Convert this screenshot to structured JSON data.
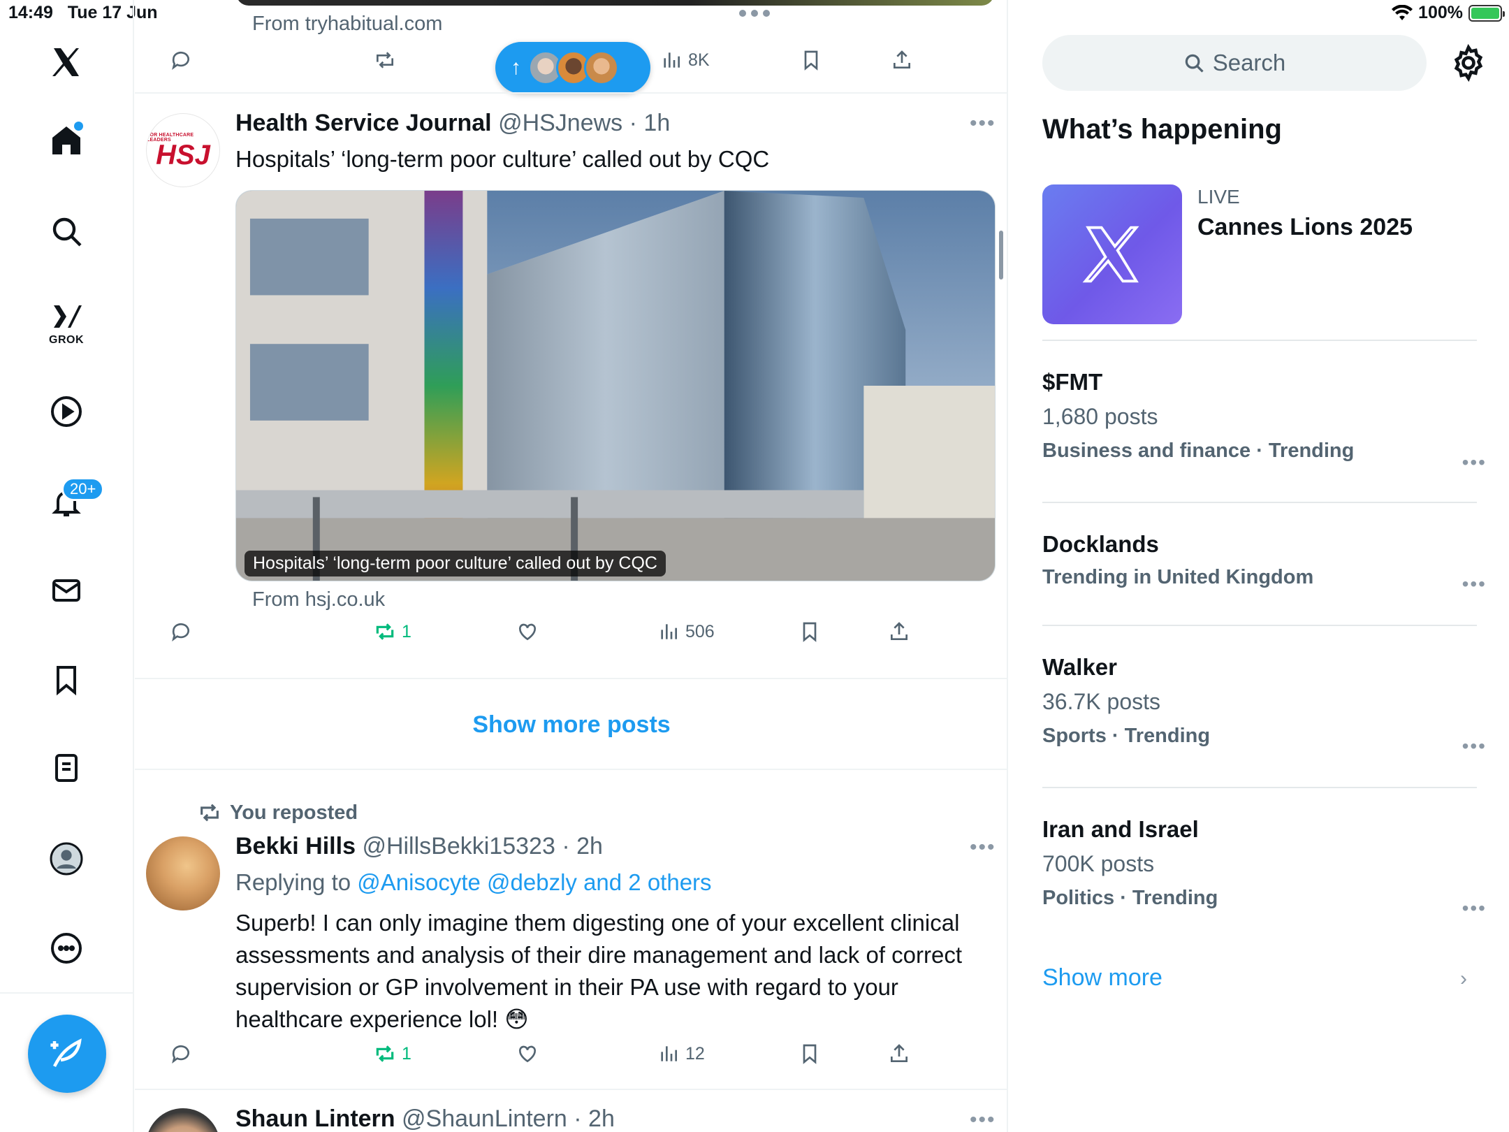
{
  "status": {
    "time": "14:49",
    "date": "Tue 17 Jun",
    "battery": "100%"
  },
  "nav": {
    "grok_label": "GROK",
    "notif_badge": "20+"
  },
  "top_tweet": {
    "source": "From tryhabitual.com",
    "views": "8K"
  },
  "hsj_tweet": {
    "avatar_small": "FOR HEALTHCARE LEADERS",
    "avatar_big": "HSJ",
    "name": "Health Service Journal",
    "handle": "@HSJnews",
    "time": "· 1h",
    "text": "Hospitals’ ‘long-term poor culture’ called out by CQC",
    "media_caption": "Hospitals’ ‘long-term poor culture’ called out by CQC",
    "source": "From hsj.co.uk",
    "reposts": "1",
    "views": "506"
  },
  "show_more_posts": "Show more posts",
  "bekki_tweet": {
    "reposted_label": "You reposted",
    "name": "Bekki Hills",
    "handle": "@HillsBekki15323",
    "time": "· 2h",
    "replying_prefix": "Replying to",
    "replying_to": "@Anisocyte @debzly and 2 others",
    "text": "Superb! I can only imagine them digesting one of your excellent clinical assessments and analysis of their dire management and lack of correct supervision or GP involvement in their PA use with regard to your healthcare experience lol! 😳",
    "reposts": "1",
    "views": "12"
  },
  "shaun_tweet": {
    "name": "Shaun Lintern",
    "handle": "@ShaunLintern",
    "time": "· 2h"
  },
  "sidebar": {
    "search_placeholder": "Search",
    "title": "What’s happening",
    "live": {
      "label": "LIVE",
      "title": "Cannes Lions 2025"
    },
    "trends": [
      {
        "name": "$FMT",
        "count": "1,680 posts",
        "category": "Business and finance · Trending"
      },
      {
        "name": "Docklands",
        "count": "",
        "category": "Trending in United Kingdom"
      },
      {
        "name": "Walker",
        "count": "36.7K posts",
        "category": "Sports · Trending"
      },
      {
        "name": "Iran and Israel",
        "count": "700K posts",
        "category": "Politics · Trending"
      }
    ],
    "show_more": "Show more"
  },
  "colors": {
    "accent": "#1d9bf0",
    "repost_green": "#00ba7c",
    "muted": "#536471"
  }
}
